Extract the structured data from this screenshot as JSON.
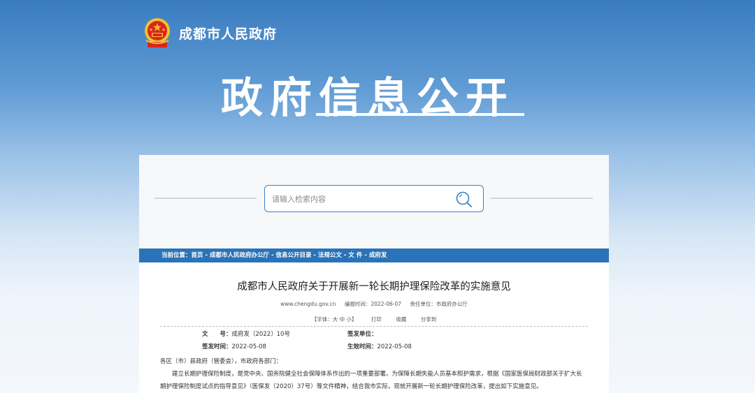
{
  "header": {
    "site_name": "成都市人民政府",
    "hero_title": "政府信息公开"
  },
  "search": {
    "placeholder": "请输入检索内容"
  },
  "breadcrumb": {
    "prefix": "当前位置：",
    "items": [
      "首页",
      "成都市人民政府办公厅",
      "信息公开目录",
      "法规公文",
      "文 件",
      "成府发"
    ],
    "separator": " - "
  },
  "document": {
    "title": "成都市人民政府关于开展新一轮长期护理保险改革的实施意见",
    "site": "www.chengdu.gov.cn",
    "edit_time_label": "编报时间：",
    "edit_time": "2022-06-07",
    "responsible_label": "责任单位：",
    "responsible": "市政府办公厅",
    "font_size_label": "【字体：大 中 小】",
    "print_label": "打印",
    "favorite_label": "收藏",
    "share_label": "分享到",
    "fields": {
      "doc_no_label": "文　　号：",
      "doc_no": "成府发〔2022〕10号",
      "issuer_label": "签发单位：",
      "issuer": "",
      "issue_date_label": "签发时间：",
      "issue_date": "2022-05-08",
      "effective_label": "生效时间：",
      "effective_date": "2022-05-08"
    },
    "body": [
      "各区（市）县政府（管委会），市政府各部门：",
      "建立长期护理保险制度，是党中央、国务院健全社会保障体系作出的一项重要部署。为保障长期失能人员基本照护需求，根据《国家医保局财政部关于扩大长",
      "期护理保险制度试点的指导意见》（医保发〔2020〕37号）等文件精神，结合我市实际，现就开展新一轮长期护理保险改革，提出如下实施意见。"
    ]
  },
  "colors": {
    "accent": "#2a73b8",
    "search_border": "#3c7fc4"
  }
}
